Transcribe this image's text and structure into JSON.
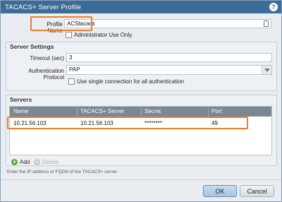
{
  "dialog": {
    "title": "TACACS+ Server Profile",
    "help_icon": "?"
  },
  "profile": {
    "name_label": "Profile Name",
    "name_value": "ACStacacs",
    "field_icon": "clipboard-icon",
    "admin_use_only_label": "Administrator Use Only",
    "admin_use_only_checked": false
  },
  "server_settings": {
    "legend": "Server Settings",
    "timeout_label": "Timeout (sec)",
    "timeout_value": "3",
    "auth_protocol_label": "Authentication Protocol",
    "auth_protocol_value": "PAP",
    "single_connection_label": "Use single connection for all authentication",
    "single_connection_checked": false
  },
  "servers": {
    "legend": "Servers",
    "columns": [
      "Name",
      "TACACS+ Server",
      "Secret",
      "Port"
    ],
    "rows": [
      {
        "name": "10.21.56.103",
        "server": "10.21.56.103",
        "secret": "********",
        "port": "49"
      }
    ],
    "add_label": "Add",
    "delete_label": "Delete",
    "hint": "Enter the IP address or FQDN of the TACACS+ server"
  },
  "footer": {
    "ok_label": "OK",
    "cancel_label": "Cancel"
  },
  "colors": {
    "titlebar": "#3d6c98",
    "highlight": "#ef7d2a",
    "table_header": "#7b8793"
  }
}
